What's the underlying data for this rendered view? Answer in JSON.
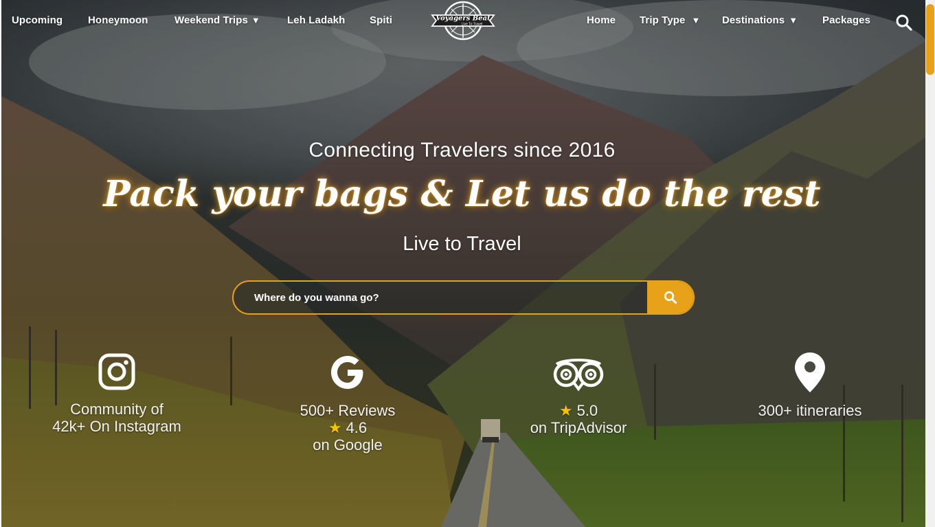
{
  "nav": {
    "left_items": [
      {
        "label": "Upcoming"
      },
      {
        "label": "Honeymoon"
      },
      {
        "label": "Weekend Trips",
        "caret": "▼"
      },
      {
        "label": "Leh Ladakh"
      },
      {
        "label": "Spiti"
      }
    ],
    "logo": {
      "brand": "Voyagers Beat",
      "tagline": "Live To Travel"
    },
    "right_items": [
      {
        "label": "Home"
      },
      {
        "label": "Trip Type",
        "caret": "▼"
      },
      {
        "label": "Destinations",
        "caret": "▼"
      },
      {
        "label": "Packages"
      }
    ],
    "search_icon": "search-icon"
  },
  "hero": {
    "tagline": "Connecting Travelers since 2016",
    "headline": "Pack your bags & Let us do the rest",
    "subline": "Live to Travel"
  },
  "search": {
    "placeholder": "Where do you wanna go?",
    "button_icon": "search-icon"
  },
  "stats": [
    {
      "icon": "instagram-icon",
      "lines": [
        "Community of",
        "42k+ On Instagram"
      ]
    },
    {
      "icon": "google-icon",
      "lines": [
        "500+ Reviews",
        "4.6",
        "on Google"
      ],
      "rating_line": 1
    },
    {
      "icon": "tripadvisor-icon",
      "lines": [
        "5.0",
        "on TripAdvisor"
      ],
      "rating_line": 0
    },
    {
      "icon": "location-pin-icon",
      "lines": [
        "300+ itineraries"
      ]
    }
  ],
  "colors": {
    "accent": "#e8a21a",
    "star": "#f5c400",
    "text": "#ffffff"
  }
}
